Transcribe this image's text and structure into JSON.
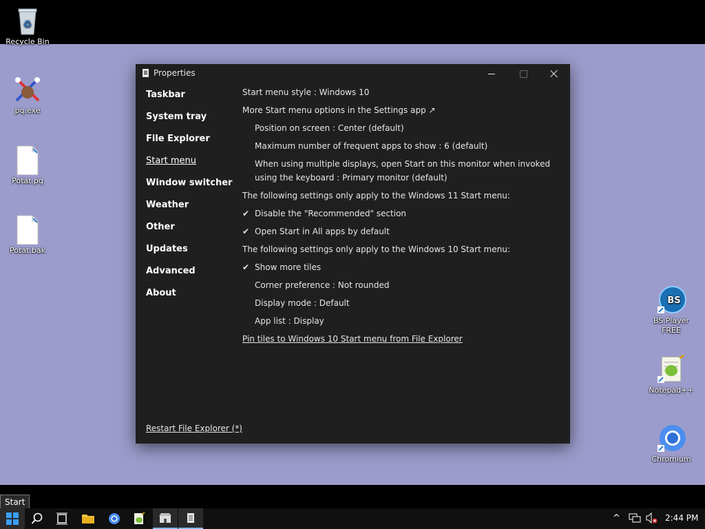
{
  "desktop": {
    "icons_left": [
      {
        "label": "Recycle Bin"
      },
      {
        "label": "pq.exe"
      },
      {
        "label": "Potat.pq"
      },
      {
        "label": "Potat.bak"
      }
    ],
    "icons_right": [
      {
        "label": "BS.Player FREE",
        "badge": "BS"
      },
      {
        "label": "Notepad++"
      },
      {
        "label": "Chromium"
      }
    ]
  },
  "window": {
    "title": "Properties",
    "nav": [
      {
        "label": "Taskbar"
      },
      {
        "label": "System tray"
      },
      {
        "label": "File Explorer"
      },
      {
        "label": "Start menu",
        "active": true
      },
      {
        "label": "Window switcher"
      },
      {
        "label": "Weather"
      },
      {
        "label": "Other"
      },
      {
        "label": "Updates"
      },
      {
        "label": "Advanced"
      },
      {
        "label": "About"
      }
    ],
    "restart_link": "Restart File Explorer (*)",
    "content": {
      "start_menu_style": "Start menu style : Windows 10",
      "more_options": "More Start menu options in the Settings app ↗",
      "position": "Position on screen : Center (default)",
      "max_frequent": "Maximum number of frequent apps to show : 6 (default)",
      "multi_display": "When using multiple displays, open Start on this monitor when invoked using the keyboard : Primary monitor (default)",
      "win11_header": "The following settings only apply to the Windows 11 Start menu:",
      "disable_recommended": "Disable the \"Recommended\" section",
      "open_all_apps": "Open Start in All apps by default",
      "win10_header": "The following settings only apply to the Windows 10 Start menu:",
      "show_more_tiles": "Show more tiles",
      "corner_pref": "Corner preference : Not rounded",
      "display_mode": "Display mode : Default",
      "app_list": "App list : Display",
      "pin_tiles": "Pin tiles to Windows 10 Start menu from File Explorer",
      "check_glyph": "✔"
    }
  },
  "taskbar": {
    "start_tooltip": "Start",
    "tray_chevron": "^",
    "time": "2:44 PM"
  }
}
